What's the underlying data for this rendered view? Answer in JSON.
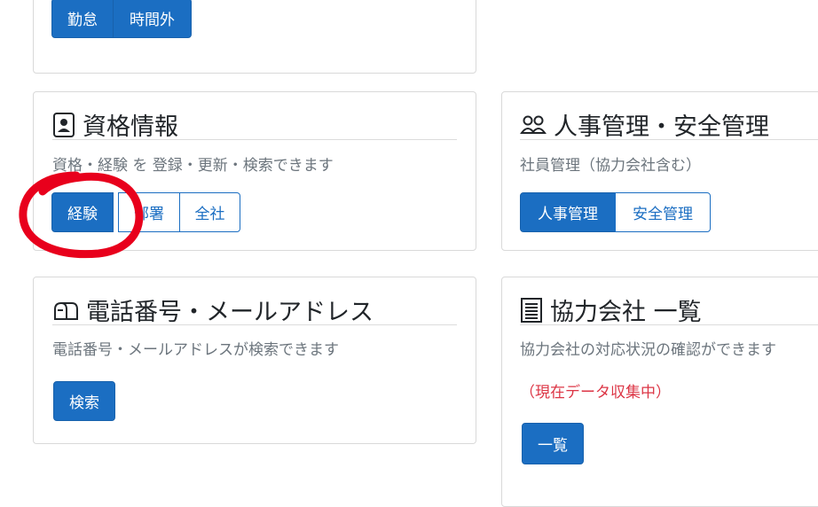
{
  "top_card": {
    "buttons": [
      "勤怠",
      "時間外"
    ]
  },
  "qualifications": {
    "icon": "id-badge-icon",
    "title": "資格情報",
    "description": "資格・経験 を 登録・更新・検索できます",
    "buttons": [
      "経験",
      "部署",
      "全社"
    ]
  },
  "hr": {
    "icon": "people-icon",
    "title": "人事管理・安全管理",
    "description": "社員管理（協力会社含む）",
    "buttons": [
      "人事管理",
      "安全管理"
    ]
  },
  "phone": {
    "icon": "mailbox-icon",
    "title": "電話番号・メールアドレス",
    "description": "電話番号・メールアドレスが検索できます",
    "button": "検索"
  },
  "partners": {
    "icon": "list-document-icon",
    "title": "協力会社 一覧",
    "description": "協力会社の対応状況の確認ができます",
    "note": "（現在データ収集中）",
    "button": "一覧"
  },
  "colors": {
    "primary": "#1b6ec2",
    "annotation": "#e8001c",
    "note": "#dc3545"
  }
}
